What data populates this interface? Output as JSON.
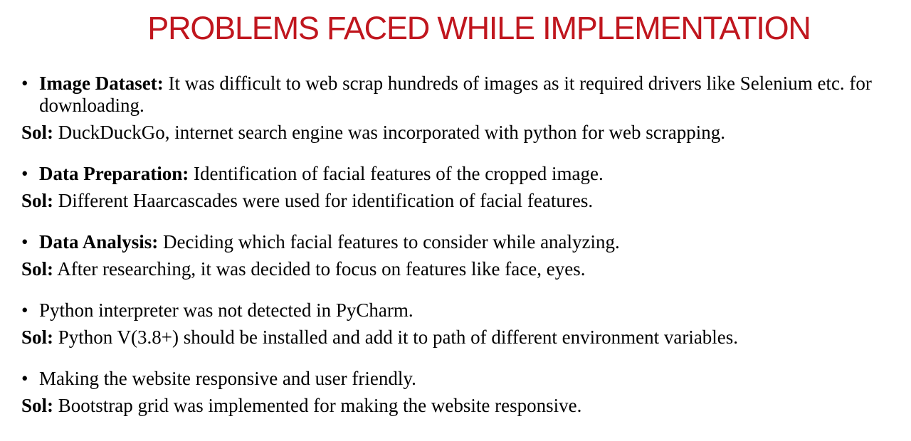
{
  "slide": {
    "title": "PROBLEMS FACED WHILE IMPLEMENTATION",
    "bullet_symbol": "•",
    "sol_label": "Sol:",
    "items": [
      {
        "heading": "Image Dataset:",
        "problem": " It was difficult to web scrap hundreds of images as it required drivers like Selenium etc. for downloading.",
        "solution": " DuckDuckGo, internet search engine was incorporated with python for web scrapping."
      },
      {
        "heading": "Data Preparation:",
        "problem": " Identification of facial features of the cropped image.",
        "solution": " Different Haarcascades were used for identification of facial features."
      },
      {
        "heading": "Data Analysis:",
        "problem": " Deciding which facial features to consider while analyzing.",
        "solution": " After researching, it was decided to focus on features like face, eyes."
      },
      {
        "heading": "",
        "problem": "Python interpreter was not detected in PyCharm.",
        "solution": " Python V(3.8+) should be installed and add it to path of different environment variables."
      },
      {
        "heading": "",
        "problem": "Making the website responsive and user friendly.",
        "solution": " Bootstrap grid was implemented for making the website responsive."
      }
    ]
  }
}
